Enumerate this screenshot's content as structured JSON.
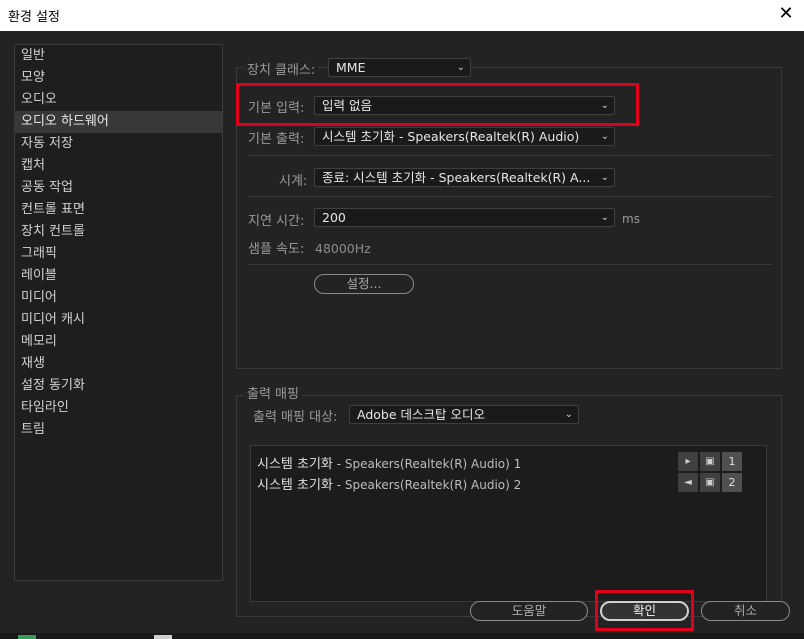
{
  "window": {
    "title": "환경 설정",
    "close_glyph": "✕"
  },
  "sidebar": {
    "items": [
      {
        "label": "일반"
      },
      {
        "label": "모양"
      },
      {
        "label": "오디오"
      },
      {
        "label": "오디오 하드웨어",
        "active": true
      },
      {
        "label": "자동 저장"
      },
      {
        "label": "캡처"
      },
      {
        "label": "공동 작업"
      },
      {
        "label": "컨트롤 표면"
      },
      {
        "label": "장치 컨트롤"
      },
      {
        "label": "그래픽"
      },
      {
        "label": "레이블"
      },
      {
        "label": "미디어"
      },
      {
        "label": "미디어 캐시"
      },
      {
        "label": "메모리"
      },
      {
        "label": "재생"
      },
      {
        "label": "설정 동기화"
      },
      {
        "label": "타임라인"
      },
      {
        "label": "트림"
      }
    ]
  },
  "hardware": {
    "device_class_label": "장치 클래스:",
    "device_class_value": "MME",
    "default_input_label": "기본 입력:",
    "default_input_value": "입력 없음",
    "default_output_label": "기본 출력:",
    "default_output_value": "시스템 초기화 - Speakers(Realtek(R) Audio)",
    "clock_label": "시계:",
    "clock_value": "종료: 시스템 초기화 - Speakers(Realtek(R) A...",
    "latency_label": "지연 시간:",
    "latency_value": "200",
    "latency_unit": "ms",
    "sample_rate_label": "샘플 속도:",
    "sample_rate_value": "48000Hz",
    "settings_button": "설정..."
  },
  "output_mapping": {
    "section_title": "출력 매핑",
    "target_label": "출력 매핑 대상:",
    "target_value": "Adobe 데스크탑 오디오",
    "rows": [
      {
        "name": "시스템 초기화",
        "detail": " - Speakers(Realtek(R) Audio) 1",
        "channel": "1",
        "icon": "play-icon"
      },
      {
        "name": "시스템 초기화",
        "detail": " - Speakers(Realtek(R) Audio) 2",
        "channel": "2",
        "icon": "speaker-icon"
      }
    ]
  },
  "footer": {
    "help_label": "도움말",
    "ok_label": "확인",
    "cancel_label": "취소"
  },
  "colors": {
    "highlight": "#e0001b",
    "background": "#232323",
    "titlebar": "#ffffff"
  }
}
